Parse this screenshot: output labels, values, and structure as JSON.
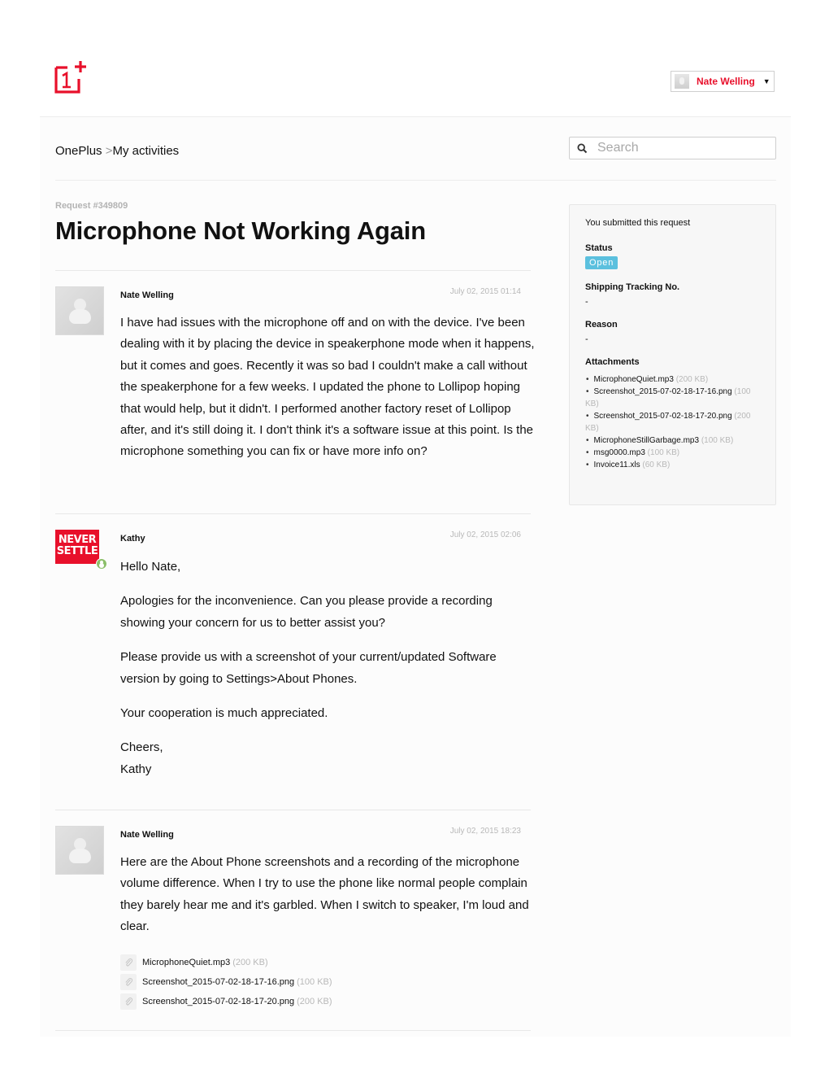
{
  "header": {
    "logo_alt": "OnePlus",
    "user_name": "Nate Welling",
    "user_caret": "▼"
  },
  "breadcrumb": {
    "root": "OnePlus",
    "separator": ">",
    "current": "My activities"
  },
  "search": {
    "placeholder": "Search",
    "value": ""
  },
  "request": {
    "id_label": "Request #349809",
    "title": "Microphone Not Working Again"
  },
  "comments": [
    {
      "author": "Nate Welling",
      "date": "July 02, 2015 01:14",
      "paragraphs": [
        "I have had issues with the microphone off and on with the device. I've been dealing with it by placing the device in speakerphone mode when it happens, but it comes and goes. Recently it was so bad I couldn't make a call without the speakerphone for a few weeks. I updated the phone to Lollipop hoping that would help, but it didn't. I performed another factory reset of Lollipop after, and it's still doing it. I don't think it's a software issue at this point. Is the microphone something you can fix or have more info on?"
      ]
    },
    {
      "author": "Kathy",
      "date": "July 02, 2015 02:06",
      "avatar_text": [
        "NEVER",
        "SETTLE"
      ],
      "paragraphs": [
        "Hello Nate,",
        "Apologies for the inconvenience. Can you please provide a recording showing your concern for us to better assist you?",
        "Please provide us with a screenshot of your current/updated Software version by going to Settings>About Phones.",
        "Your cooperation is much appreciated.",
        "Cheers,",
        "Kathy"
      ]
    },
    {
      "author": "Nate Welling",
      "date": "July 02, 2015 18:23",
      "paragraphs": [
        "Here are the About Phone screenshots and a recording of the microphone volume difference. When I try to use the phone like normal people complain they barely hear me and it's garbled. When I switch to speaker, I'm loud and clear."
      ],
      "attachments": [
        {
          "name": "MicrophoneQuiet.mp3",
          "size": "(200 KB)"
        },
        {
          "name": "Screenshot_2015-07-02-18-17-16.png",
          "size": "(100 KB)"
        },
        {
          "name": "Screenshot_2015-07-02-18-17-20.png",
          "size": "(200 KB)"
        }
      ]
    }
  ],
  "sidebar": {
    "submitted_text": "You submitted this request",
    "status_label": "Status",
    "status_value": "Open",
    "status_color": "#5bc0de",
    "tracking_label": "Shipping Tracking No.",
    "tracking_value": "-",
    "reason_label": "Reason",
    "reason_value": "-",
    "attachments_label": "Attachments",
    "attachments": [
      {
        "name": "MicrophoneQuiet.mp3",
        "size": "(200 KB)"
      },
      {
        "name": "Screenshot_2015-07-02-18-17-16.png",
        "size": "(100 KB)"
      },
      {
        "name": "Screenshot_2015-07-02-18-17-20.png",
        "size": "(200 KB)"
      },
      {
        "name": "MicrophoneStillGarbage.mp3",
        "size": "(100 KB)"
      },
      {
        "name": "msg0000.mp3",
        "size": "(100 KB)"
      },
      {
        "name": "Invoice11.xls",
        "size": "(60 KB)"
      }
    ]
  },
  "colors": {
    "brand": "#e8102b",
    "muted": "#b8b8b8",
    "agent_badge": "#8cbf6a"
  }
}
